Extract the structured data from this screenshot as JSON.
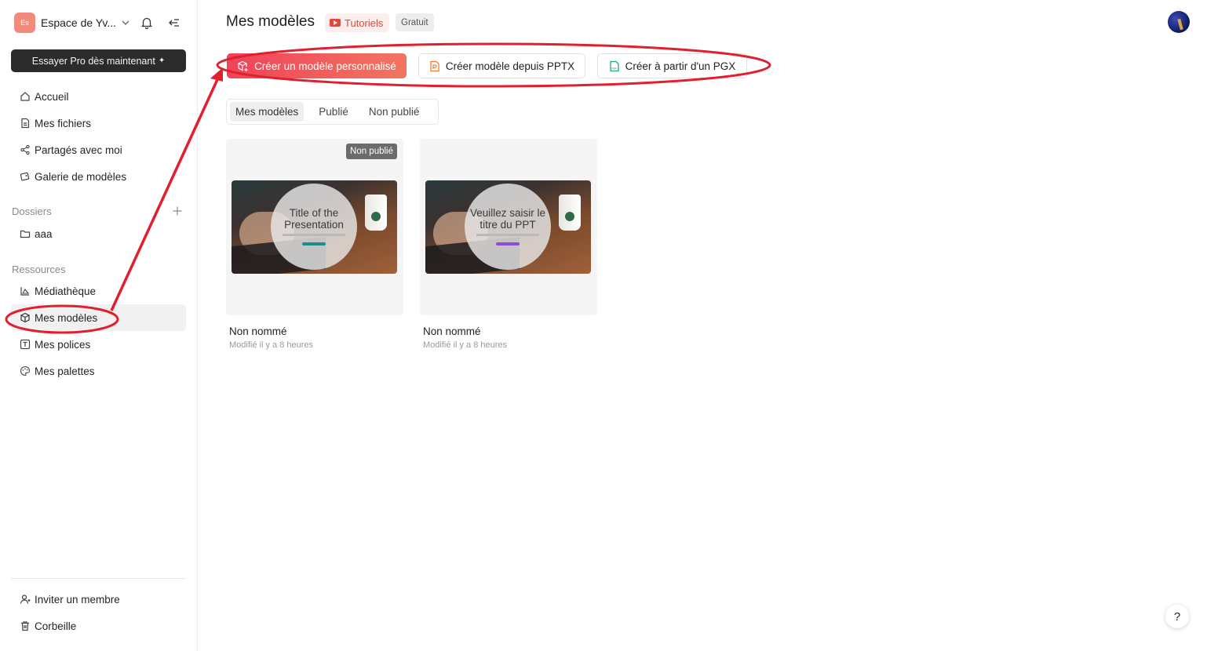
{
  "workspace": {
    "badge": "Es",
    "name": "Espace de Yv..."
  },
  "promo": {
    "label": "Essayer Pro dès maintenant",
    "spark": "✦"
  },
  "nav": {
    "items": [
      {
        "label": "Accueil",
        "icon": "home-icon"
      },
      {
        "label": "Mes fichiers",
        "icon": "file-icon"
      },
      {
        "label": "Partagés avec moi",
        "icon": "share-icon"
      },
      {
        "label": "Galerie de modèles",
        "icon": "gallery-icon"
      }
    ]
  },
  "folders": {
    "label": "Dossiers",
    "items": [
      {
        "label": "aaa",
        "icon": "folder-icon"
      }
    ]
  },
  "resources": {
    "label": "Ressources",
    "items": [
      {
        "label": "Médiathèque",
        "icon": "media-icon"
      },
      {
        "label": "Mes modèles",
        "icon": "cube-icon",
        "active": true
      },
      {
        "label": "Mes polices",
        "icon": "font-icon"
      },
      {
        "label": "Mes palettes",
        "icon": "palette-icon"
      }
    ]
  },
  "footer": {
    "invite": "Inviter un membre",
    "trash": "Corbeille"
  },
  "header": {
    "title": "Mes modèles",
    "tutorials": "Tutoriels",
    "plan": "Gratuit"
  },
  "actions": {
    "create_custom": "Créer un modèle personnalisé",
    "create_pptx": "Créer modèle depuis PPTX",
    "create_pgx": "Créer à partir d'un PGX"
  },
  "tabs": [
    "Mes modèles",
    "Publié",
    "Non publié"
  ],
  "cards": [
    {
      "badge": "Non publié",
      "slide_title": "Title of the Presentation",
      "name": "Non nommé",
      "modified": "Modifié il y a 8 heures"
    },
    {
      "badge": "",
      "slide_title": "Veuillez saisir le titre du PPT",
      "name": "Non nommé",
      "modified": "Modifié il y a 8 heures"
    }
  ],
  "help": "?",
  "colors": {
    "accent": "#f0435a",
    "annotation": "#e0202e"
  }
}
